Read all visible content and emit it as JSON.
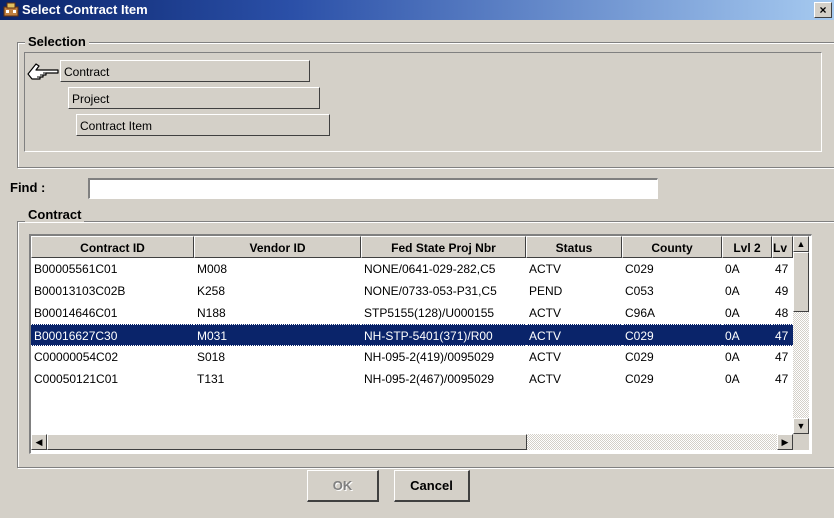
{
  "window": {
    "title": "Select Contract Item",
    "close_glyph": "×"
  },
  "selection": {
    "label": "Selection",
    "tiers": [
      "Contract",
      "Project",
      "Contract Item"
    ],
    "pointer_icon": "hand-pointer-icon"
  },
  "find": {
    "label": "Find :",
    "value": "",
    "placeholder": ""
  },
  "contract": {
    "label": "Contract",
    "columns": [
      "Contract ID",
      "Vendor ID",
      "Fed State Proj Nbr",
      "Status",
      "County",
      "Lvl 2",
      "Lv"
    ],
    "rows": [
      [
        "B00005561C01",
        "M008",
        "NONE/0641-029-282,C5",
        "ACTV",
        "C029",
        "0A",
        "47"
      ],
      [
        "B00013103C02B",
        "K258",
        "NONE/0733-053-P31,C5",
        "PEND",
        "C053",
        "0A",
        "49"
      ],
      [
        "B00014646C01",
        "N188",
        "STP5155(128)/U000155",
        "ACTV",
        "C96A",
        "0A",
        "48"
      ],
      [
        "B00016627C30",
        "M031",
        "NH-STP-5401(371)/R00",
        "ACTV",
        "C029",
        "0A",
        "47"
      ],
      [
        "C00000054C02",
        "S018",
        "NH-095-2(419)/0095029",
        "ACTV",
        "C029",
        "0A",
        "47"
      ],
      [
        "C00050121C01",
        "T131",
        "NH-095-2(467)/0095029",
        "ACTV",
        "C029",
        "0A",
        "47"
      ]
    ],
    "selected_row": 3
  },
  "buttons": {
    "ok": "OK",
    "cancel": "Cancel"
  },
  "colors": {
    "title_start": "#0a246a",
    "title_end": "#a6caf0",
    "selection": "#0a246a",
    "face": "#d4d0c8"
  }
}
